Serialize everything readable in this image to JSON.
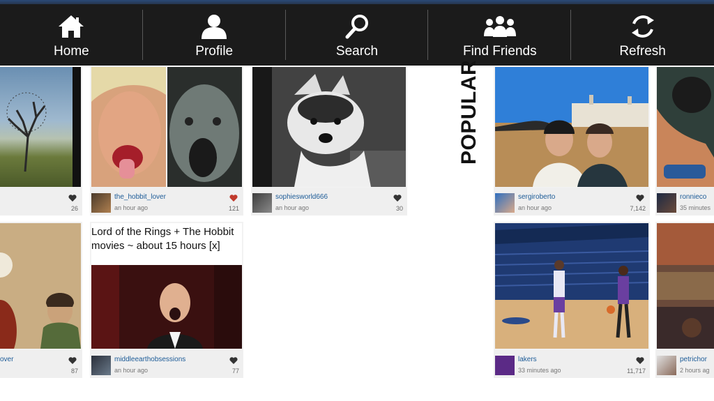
{
  "nav": [
    {
      "label": "Home",
      "icon": "home-icon"
    },
    {
      "label": "Profile",
      "icon": "profile-icon"
    },
    {
      "label": "Search",
      "icon": "search-icon"
    },
    {
      "label": "Find Friends",
      "icon": "friends-icon"
    },
    {
      "label": "Refresh",
      "icon": "refresh-icon"
    }
  ],
  "section_label": "POPULAR",
  "feed": {
    "tile1": {
      "count": "26"
    },
    "tile2": {
      "user": "the_hobbit_lover",
      "time": "an hour ago",
      "count": "121",
      "liked": true
    },
    "tile3": {
      "user": "sophiesworld666",
      "time": "an hour ago",
      "count": "30"
    },
    "tile4": {
      "user": "over",
      "count": "87"
    },
    "tile5": {
      "caption": "Lord of the Rings + The Hobbit movies ~ about 15 hours [x]",
      "user": "middleearthobsessions",
      "time": "an hour ago",
      "count": "77"
    }
  },
  "popular": {
    "tile1": {
      "user": "sergiroberto",
      "time": "an hour ago",
      "count": "7,142"
    },
    "tile2": {
      "user": "ronnieco",
      "time": "35 minutes"
    },
    "tile3": {
      "user": "lakers",
      "time": "33 minutes ago",
      "count": "11,717"
    },
    "tile4": {
      "user": "petrichor",
      "time": "2 hours ag"
    }
  },
  "colors": {
    "username": "#1c5b97",
    "like_red": "#c0392b",
    "nav_bg": "#1b1b1b"
  }
}
